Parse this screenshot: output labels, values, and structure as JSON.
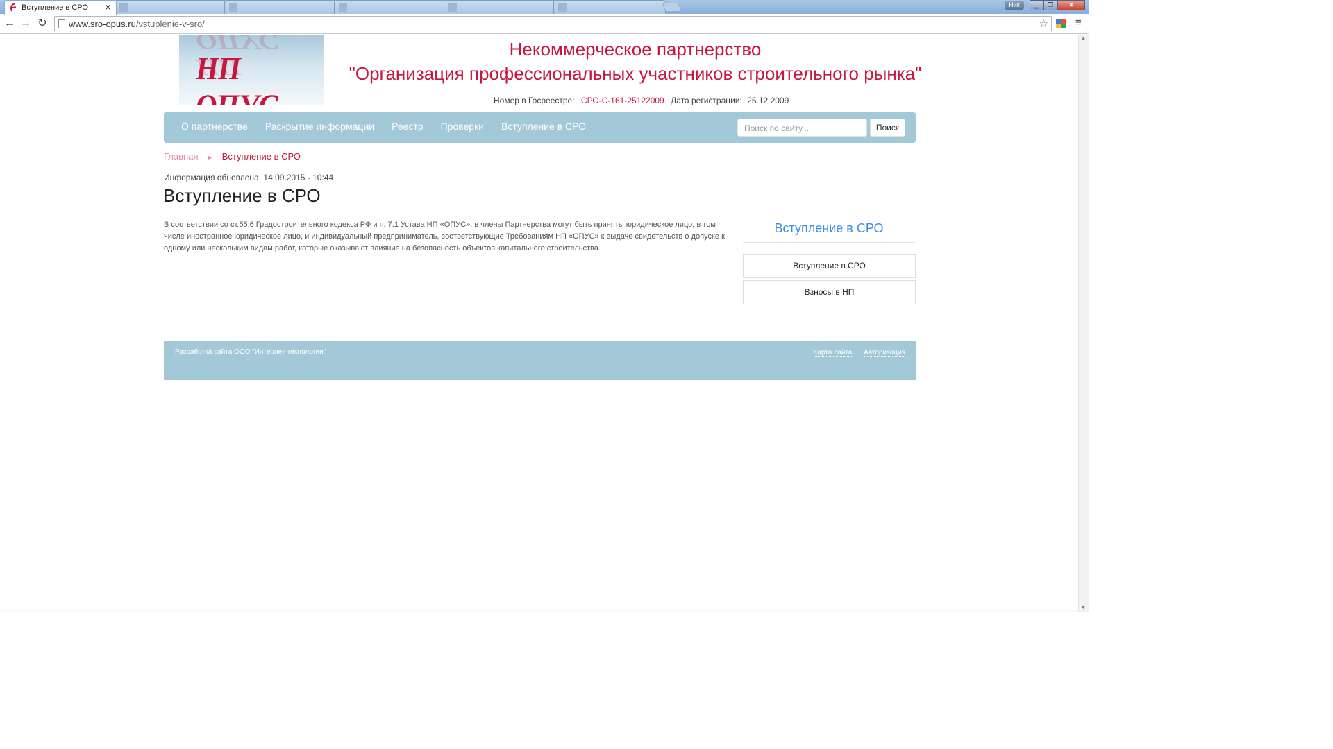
{
  "browser": {
    "tabs": [
      {
        "title": "Вступление в СРО",
        "active": true
      },
      {
        "title": "",
        "active": false
      },
      {
        "title": "",
        "active": false
      },
      {
        "title": "",
        "active": false
      },
      {
        "title": "",
        "active": false
      },
      {
        "title": "",
        "active": false
      }
    ],
    "user_label": "Ник",
    "url_host": "www.sro-opus.ru",
    "url_path": "/vstuplenie-v-sro/"
  },
  "header": {
    "logo_text": "НП ОПУС",
    "org_line1": "Некоммерческое партнерство",
    "org_line2": "\"Организация профессиональных участников строительного рынка\"",
    "registry_label": "Номер в Госреестре:",
    "registry_number": "СРО-С-161-25122009",
    "reg_date_label": "Дата регистрации:",
    "reg_date": "25.12.2009"
  },
  "nav": {
    "items": [
      "О партнерстве",
      "Раскрытие информации",
      "Реестр",
      "Проверки",
      "Вступление в СРО"
    ],
    "search_placeholder": "Поиск по сайту....",
    "search_button": "Поиск"
  },
  "breadcrumb": {
    "home": "Главная",
    "current": "Вступление в СРО"
  },
  "content": {
    "updated": "Информация обновлена: 14.09.2015 - 10:44",
    "title": "Вступление в СРО",
    "body": "В соответствии со ст.55.6 Градостроительного кодекса РФ и п. 7.1 Устава НП «ОПУС», в члены Партнерства могут быть приняты юридическое лицо, в том числе иностранное юридическое лицо, и индивидуальный предприниматель, соответствующие Требованиям НП «ОПУС» к выдаче свидетельств о допуске к одному или нескольким видам работ, которые оказывают влияние на безопасность объектов капитального строительства."
  },
  "sidebar": {
    "title": "Вступление в СРО",
    "items": [
      "Вступление в СРО",
      "Взносы в НП"
    ]
  },
  "footer": {
    "developer": "Разработка сайта ООО \"Интернет-технологии\"",
    "sitemap": "Карта сайта",
    "login": "Авторизация"
  },
  "colors": {
    "brand_red": "#c8173e",
    "nav_blue": "#a3c8d8",
    "link_blue": "#3a8ee6"
  }
}
